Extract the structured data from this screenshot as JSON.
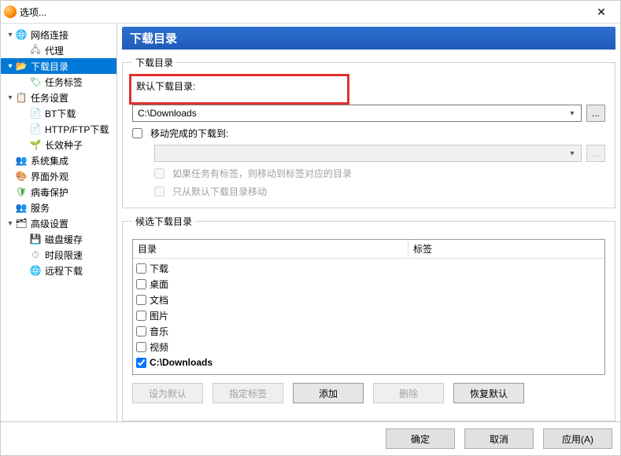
{
  "window": {
    "title": "选项..."
  },
  "sidebar": {
    "items": [
      {
        "label": "网络连接",
        "icon": "ic-globe",
        "exp": "▾",
        "children": [
          {
            "label": "代理",
            "icon": "ic-proxy"
          }
        ]
      },
      {
        "label": "下载目录",
        "icon": "ic-folder",
        "exp": "▾",
        "selected": true,
        "children": [
          {
            "label": "任务标签",
            "icon": "ic-tag"
          }
        ]
      },
      {
        "label": "任务设置",
        "icon": "ic-task",
        "exp": "▾",
        "children": [
          {
            "label": "BT下载",
            "icon": "ic-bt"
          },
          {
            "label": "HTTP/FTP下载",
            "icon": "ic-http"
          },
          {
            "label": "长效种子",
            "icon": "ic-seed"
          }
        ]
      },
      {
        "label": "系统集成",
        "icon": "ic-sys"
      },
      {
        "label": "界面外观",
        "icon": "ic-appearance"
      },
      {
        "label": "病毒保护",
        "icon": "ic-virus"
      },
      {
        "label": "服务",
        "icon": "ic-service"
      },
      {
        "label": "高级设置",
        "icon": "ic-adv",
        "exp": "▾",
        "children": [
          {
            "label": "磁盘缓存",
            "icon": "ic-disk"
          },
          {
            "label": "时段限速",
            "icon": "ic-time"
          },
          {
            "label": "远程下载",
            "icon": "ic-remote"
          }
        ]
      }
    ]
  },
  "main": {
    "banner": "下载目录",
    "group1": {
      "legend": "下载目录",
      "default_dir_label": "默认下载目录:",
      "default_dir_value": "C:\\Downloads",
      "browse": "...",
      "move_completed_label": "移动完成的下载到:",
      "move_completed_checked": false,
      "move_dir_value": "",
      "tag_move_label": "如果任务有标签，则移动到标签对应的目录",
      "tag_move_checked": false,
      "only_default_label": "只从默认下载目录移动",
      "only_default_checked": false
    },
    "group2": {
      "legend": "候选下载目录",
      "col_dir": "目录",
      "col_tag": "标签",
      "rows": [
        {
          "label": "下载",
          "checked": false
        },
        {
          "label": "桌面",
          "checked": false
        },
        {
          "label": "文档",
          "checked": false
        },
        {
          "label": "图片",
          "checked": false
        },
        {
          "label": "音乐",
          "checked": false
        },
        {
          "label": "视频",
          "checked": false
        },
        {
          "label": "C:\\Downloads",
          "checked": true,
          "bold": true
        }
      ],
      "buttons": {
        "set_default": "设为默认",
        "set_tag": "指定标签",
        "add": "添加",
        "delete": "删除",
        "restore": "恢复默认"
      }
    }
  },
  "footer": {
    "ok": "确定",
    "cancel": "取消",
    "apply": "应用(A)"
  }
}
